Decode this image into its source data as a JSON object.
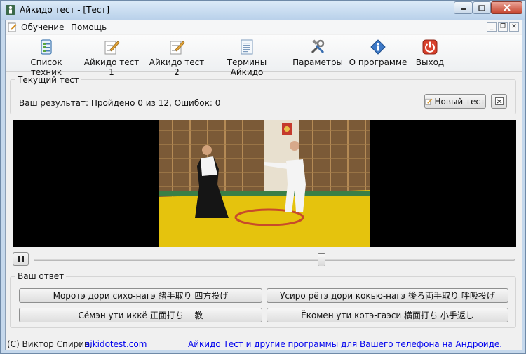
{
  "window": {
    "title": "Айкидо тест - [Тест]"
  },
  "menu": {
    "items": [
      "Обучение",
      "Помощь"
    ]
  },
  "toolbar": {
    "buttons": [
      {
        "label": "Список техник",
        "icon": "list-icon"
      },
      {
        "label": "Айкидо тест 1",
        "icon": "pencil-note-icon"
      },
      {
        "label": "Айкидо тест 2",
        "icon": "pencil-note-icon"
      },
      {
        "label": "Термины Айкидо",
        "icon": "document-icon"
      },
      {
        "label": "Параметры",
        "icon": "tools-icon"
      },
      {
        "label": "О программе",
        "icon": "info-icon"
      },
      {
        "label": "Выход",
        "icon": "power-icon"
      }
    ]
  },
  "current_test": {
    "title": "Текущий тест",
    "result_label": "Ваш результат:",
    "result_value": "Пройдено 0 из 12, Ошибок: 0",
    "new_test_label": "Новый тест"
  },
  "player": {
    "pause_icon": "pause-icon",
    "progress": 0.6
  },
  "answer": {
    "title": "Ваш ответ",
    "options": [
      "Моротэ дори сихо-нагэ 諸手取り 四方投げ",
      "Усиро рётэ дори кокью-нагэ 後ろ両手取り 呼吸投げ",
      "Сёмэн ути иккё 正面打ち 一教",
      "Ёкомен ути котэ-гаэси 横面打ち 小手返し"
    ]
  },
  "status": {
    "author": "(C) Виктор Спирин,",
    "site_link": "aikidotest.com",
    "promo_link": "Айкидо Тест и другие программы для Вашего телефона на Андроиде."
  },
  "colors": {
    "titlebar": "#c5d8ec",
    "mat": "#e5c30d",
    "close": "#c6442d"
  }
}
